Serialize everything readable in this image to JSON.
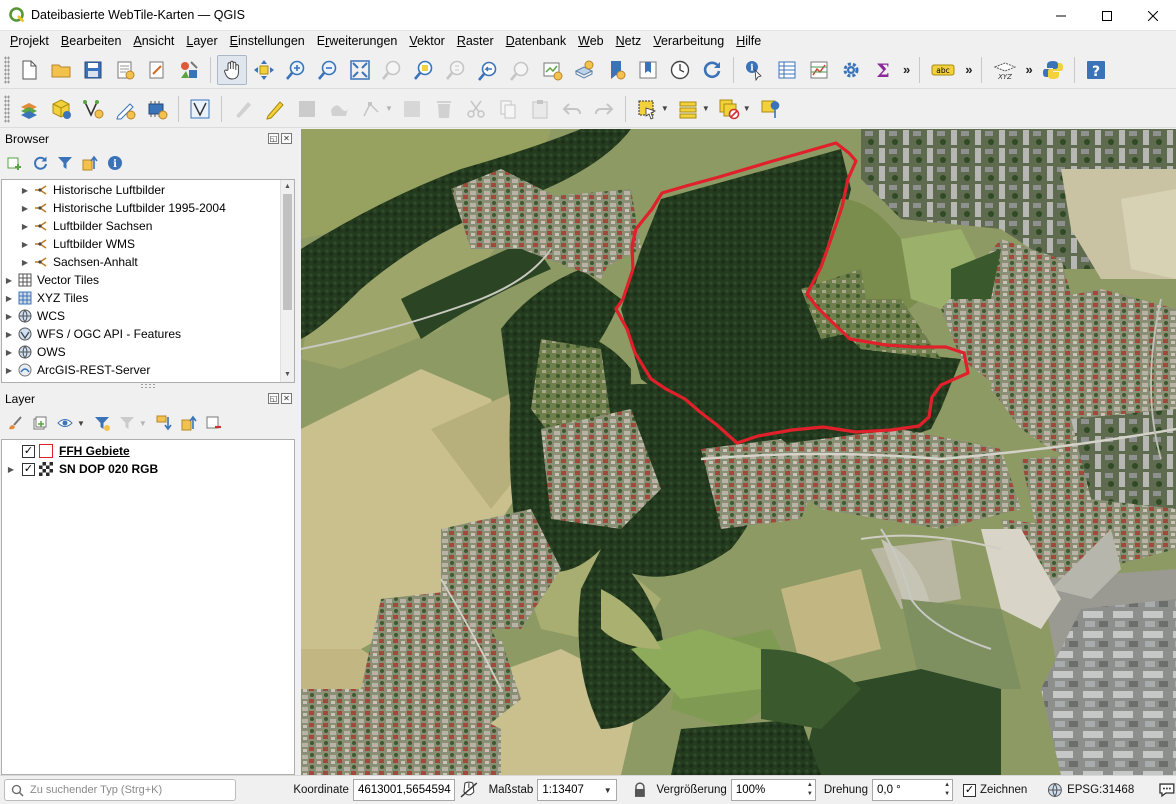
{
  "window": {
    "title": "Dateibasierte WebTile-Karten — QGIS",
    "controls": [
      "minimize",
      "maximize",
      "close"
    ]
  },
  "menubar": {
    "items": [
      {
        "label": "Projekt",
        "accel": "P"
      },
      {
        "label": "Bearbeiten",
        "accel": "B"
      },
      {
        "label": "Ansicht",
        "accel": "A"
      },
      {
        "label": "Layer",
        "accel": "L"
      },
      {
        "label": "Einstellungen",
        "accel": "E"
      },
      {
        "label": "Erweiterungen",
        "accel": "r"
      },
      {
        "label": "Vektor",
        "accel": "V"
      },
      {
        "label": "Raster",
        "accel": "R"
      },
      {
        "label": "Datenbank",
        "accel": "D"
      },
      {
        "label": "Web",
        "accel": "W"
      },
      {
        "label": "Netz",
        "accel": "N"
      },
      {
        "label": "Verarbeitung",
        "accel": "V"
      },
      {
        "label": "Hilfe",
        "accel": "H"
      }
    ]
  },
  "toolbar": {
    "more_glyph": "»",
    "abc_label": "abc",
    "xyz_label": "XYZ",
    "sigma": "Σ"
  },
  "browser": {
    "title": "Browser",
    "items": [
      {
        "label": "Historische Luftbilder",
        "icon": "wms-icon",
        "level": 1
      },
      {
        "label": "Historische Luftbilder 1995-2004",
        "icon": "wms-icon",
        "level": 1
      },
      {
        "label": "Luftbilder Sachsen",
        "icon": "wms-icon",
        "level": 1
      },
      {
        "label": "Luftbilder WMS",
        "icon": "wms-icon",
        "level": 1
      },
      {
        "label": "Sachsen-Anhalt",
        "icon": "wms-icon",
        "level": 1
      },
      {
        "label": "Vector Tiles",
        "icon": "vector-tiles-icon",
        "level": 0
      },
      {
        "label": "XYZ Tiles",
        "icon": "xyz-tiles-icon",
        "level": 0
      },
      {
        "label": "WCS",
        "icon": "globe-icon",
        "level": 0
      },
      {
        "label": "WFS / OGC API - Features",
        "icon": "wfs-icon",
        "level": 0
      },
      {
        "label": "OWS",
        "icon": "globe-icon",
        "level": 0
      },
      {
        "label": "ArcGIS-REST-Server",
        "icon": "arcgis-icon",
        "level": 0
      }
    ]
  },
  "layers": {
    "title": "Layer",
    "items": [
      {
        "label": "FFH Gebiete",
        "checked": true,
        "symbol_color": "#e0202a"
      },
      {
        "label": "SN DOP 020 RGB",
        "checked": true,
        "symbol_color": "#2b2b2b"
      }
    ]
  },
  "statusbar": {
    "locator_placeholder": "Zu suchender Typ (Strg+K)",
    "coordinate_label": "Koordinate",
    "coordinate_value": "4613001,5654594",
    "scale_label": "Maßstab",
    "scale_value": "1:13407",
    "magnifier_label": "Vergrößerung",
    "magnifier_value": "100%",
    "rotation_label": "Drehung",
    "rotation_value": "0,0 °",
    "render_label": "Zeichnen",
    "render_checked": true,
    "crs_label": "EPSG:31468"
  },
  "colors": {
    "ffh_outline": "#e0202a",
    "forest": "#233a1e",
    "fields": "#c9c08e",
    "accent": "#3b73b9"
  }
}
